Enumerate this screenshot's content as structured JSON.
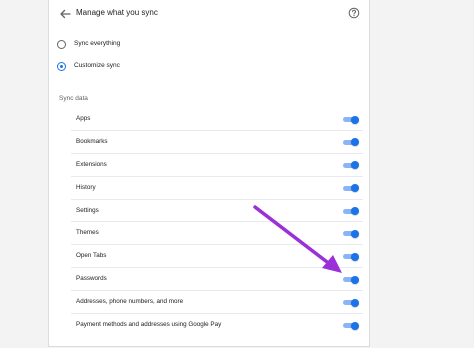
{
  "header": {
    "title": "Manage what you sync",
    "back_icon": "arrow-back-icon",
    "help_icon": "help-circle-icon"
  },
  "sync_mode": {
    "options": [
      {
        "label": "Sync everything",
        "selected": false
      },
      {
        "label": "Customize sync",
        "selected": true
      }
    ]
  },
  "sync_data": {
    "section_label": "Sync data",
    "items": [
      {
        "label": "Apps",
        "enabled": true
      },
      {
        "label": "Bookmarks",
        "enabled": true
      },
      {
        "label": "Extensions",
        "enabled": true
      },
      {
        "label": "History",
        "enabled": true
      },
      {
        "label": "Settings",
        "enabled": true
      },
      {
        "label": "Themes",
        "enabled": true
      },
      {
        "label": "Open Tabs",
        "enabled": true
      },
      {
        "label": "Passwords",
        "enabled": true
      },
      {
        "label": "Addresses, phone numbers, and more",
        "enabled": true
      },
      {
        "label": "Payment methods and addresses using Google Pay",
        "enabled": true
      }
    ]
  },
  "colors": {
    "accent": "#1a73e8",
    "toggle_track": "#8ab4f8",
    "annotation_arrow": "#9b30d9"
  }
}
